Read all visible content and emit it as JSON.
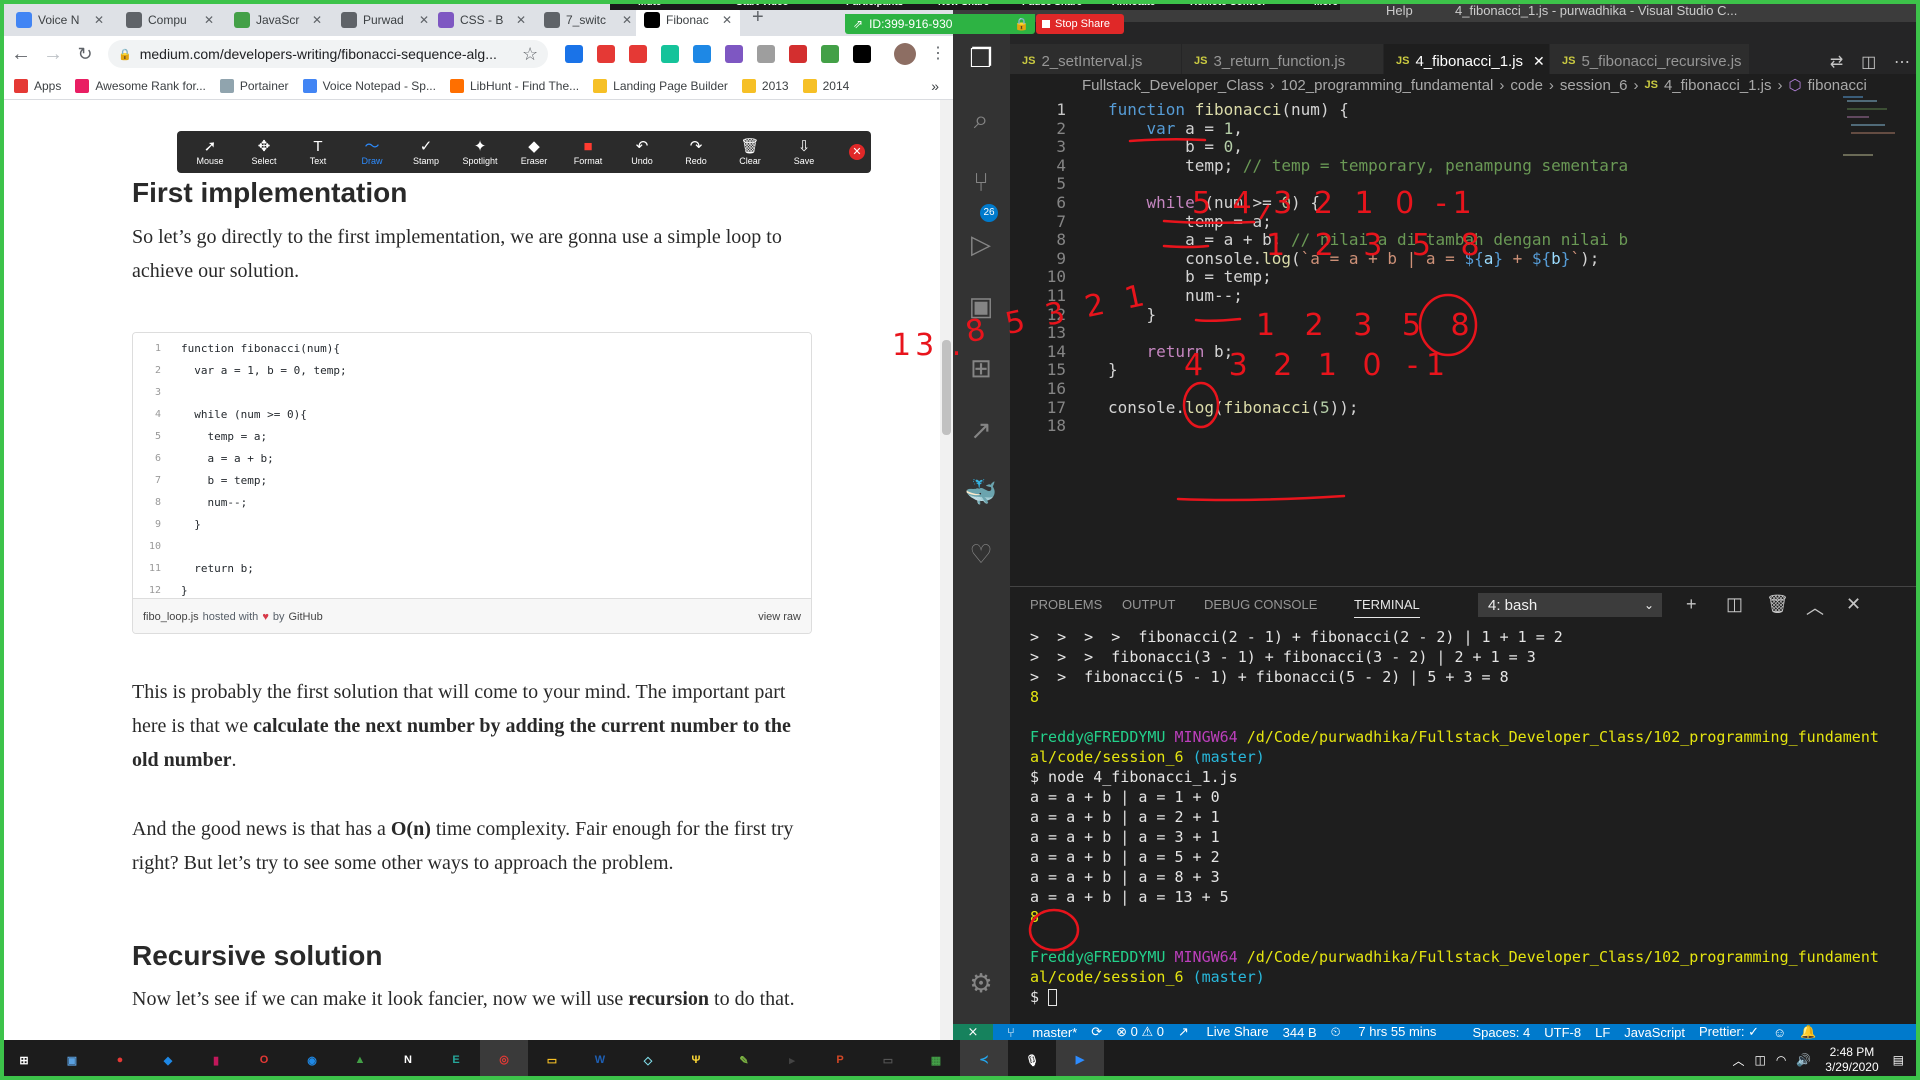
{
  "browser": {
    "tabs": [
      {
        "label": "Voice N",
        "fav": "#4285f4"
      },
      {
        "label": "Compu",
        "fav": "#5f6368"
      },
      {
        "label": "JavaScr",
        "fav": "#43a047"
      },
      {
        "label": "Purwad",
        "fav": "#5f6368"
      },
      {
        "label": "CSS - B",
        "fav": "#7e57c2"
      },
      {
        "label": "7_switc",
        "fav": "#5f6368"
      },
      {
        "label": "Fibonac",
        "fav": "#000000"
      }
    ],
    "new_tab": "+",
    "url": "medium.com/developers-writing/fibonacci-sequence-alg...",
    "bookmarks": [
      {
        "label": "Apps",
        "color": "#e53935"
      },
      {
        "label": "Awesome Rank for...",
        "color": "#e91e63"
      },
      {
        "label": "Portainer",
        "color": "#90a4ae"
      },
      {
        "label": "Voice Notepad - Sp...",
        "color": "#4285f4"
      },
      {
        "label": "LibHunt - Find The...",
        "color": "#ff6f00"
      },
      {
        "label": "Landing Page Builder",
        "color": "#f6c026"
      },
      {
        "label": "2013",
        "color": "#f6c026"
      },
      {
        "label": "2014",
        "color": "#f6c026"
      }
    ],
    "bookmarks_more": "»"
  },
  "zoom": {
    "top_items": [
      "Mute",
      "Start Video",
      "Participants",
      "New Share",
      "Pause Share",
      "Annotate",
      "Remote Control",
      "More"
    ],
    "meeting_id": "ID:399-916-930",
    "stop_share": "Stop Share",
    "toolbar": [
      {
        "label": "Mouse",
        "icon": "➚"
      },
      {
        "label": "Select",
        "icon": "✥"
      },
      {
        "label": "Text",
        "icon": "T"
      },
      {
        "label": "Draw",
        "icon": "〜"
      },
      {
        "label": "Stamp",
        "icon": "✓"
      },
      {
        "label": "Spotlight",
        "icon": "✦"
      },
      {
        "label": "Eraser",
        "icon": "◆"
      },
      {
        "label": "Format",
        "icon": "■"
      },
      {
        "label": "Undo",
        "icon": "↶"
      },
      {
        "label": "Redo",
        "icon": "↷"
      },
      {
        "label": "Clear",
        "icon": "🗑"
      },
      {
        "label": "Save",
        "icon": "⇩"
      }
    ],
    "close": "✕"
  },
  "article": {
    "heading1": "First implementation",
    "intro": "So let’s go directly to the first implementation, we are gonna use a simple loop to achieve our solution.",
    "gist_lines": [
      {
        "n": "1",
        "code": "function fibonacci(num){"
      },
      {
        "n": "2",
        "code": "  var a = 1, b = 0, temp;"
      },
      {
        "n": "3",
        "code": ""
      },
      {
        "n": "4",
        "code": "  while (num >= 0){"
      },
      {
        "n": "5",
        "code": "    temp = a;"
      },
      {
        "n": "6",
        "code": "    a = a + b;"
      },
      {
        "n": "7",
        "code": "    b = temp;"
      },
      {
        "n": "8",
        "code": "    num--;"
      },
      {
        "n": "9",
        "code": "  }"
      },
      {
        "n": "10",
        "code": ""
      },
      {
        "n": "11",
        "code": "  return b;"
      },
      {
        "n": "12",
        "code": "}"
      }
    ],
    "gist_file": "fibo_loop.js",
    "gist_hosted": "hosted with",
    "gist_by": "by",
    "gist_github": "GitHub",
    "gist_raw": "view raw",
    "p1_a": "This is probably the first solution that will come to your mind. The important part here is that we ",
    "p1_b": "calculate the next number by adding the current number to the old number",
    "p1_c": ".",
    "p2_a": "And the good news is that has a ",
    "p2_b": "O(n)",
    "p2_c": " time complexity. Fair enough for the first try right? But let’s try to see some other ways to approach the problem.",
    "heading2": "Recursive solution",
    "p3_a": "Now let’s see if we can make it look fancier, now we will use ",
    "p3_b": "recursion",
    "p3_c": " to do that."
  },
  "vscode": {
    "title_items": [
      "Help",
      "4_fibonacci_1.js - purwadhika - Visual Studio C..."
    ],
    "tabs": [
      {
        "label": "2_setInterval.js",
        "active": false
      },
      {
        "label": "3_return_function.js",
        "active": false
      },
      {
        "label": "4_fibonacci_1.js",
        "active": true
      },
      {
        "label": "5_fibonacci_recursive.js",
        "active": false
      }
    ],
    "js_tag": "JS",
    "breadcrumb": [
      "Fullstack_Developer_Class",
      "102_programming_fundamental",
      "code",
      "session_6",
      "4_fibonacci_1.js",
      "fibonacci"
    ],
    "badge": "26",
    "code_lines": [
      "function fibonacci(num) {",
      "    var a = 1,",
      "        b = 0,",
      "        temp; // temp = temporary, penampung sementara",
      "",
      "    while (num >= 0) {",
      "        temp = a;",
      "        a = a + b; // nilai a di tambah dengan nilai b",
      "        console.log(`a = a + b | a = ${a} + ${b}`);",
      "        b = temp;",
      "        num--;",
      "    }",
      "",
      "    return b;",
      "}",
      "",
      "console.log(fibonacci(5));",
      ""
    ],
    "panel_tabs": [
      "PROBLEMS",
      "OUTPUT",
      "DEBUG CONSOLE",
      "TERMINAL"
    ],
    "terminal_select": "4: bash",
    "terminal": {
      "l1": ">  >  >  >  fibonacci(2 - 1) + fibonacci(2 - 2) | 1 + 1 = 2",
      "l2": ">  >  >  fibonacci(3 - 1) + fibonacci(3 - 2) | 2 + 1 = 3",
      "l3": ">  >  fibonacci(5 - 1) + fibonacci(5 - 2) | 5 + 3 = 8",
      "l4": "8",
      "user": "Freddy@FREDDYMU",
      "env": "MINGW64",
      "path1": "/d/Code/purwadhika/Fullstack_Developer_Class/102_programming_fundament",
      "path2": "al/code/session_6",
      "branch": "(master)",
      "cmd": "$ node 4_fibonacci_1.js",
      "out": [
        "a = a + b | a = 1 + 0",
        "a = a + b | a = 2 + 1",
        "a = a + b | a = 3 + 1",
        "a = a + b | a = 5 + 2",
        "a = a + b | a = 8 + 3",
        "a = a + b | a = 13 + 5"
      ],
      "result": "8",
      "prompt": "$ "
    },
    "status": {
      "branch": "master*",
      "problems": "⊗ 0 ⚠ 0",
      "liveshare": "Live Share",
      "size": "344 B",
      "time": "7 hrs 55 mins",
      "spaces": "Spaces: 4",
      "encoding": "UTF-8",
      "eol": "LF",
      "language": "JavaScript",
      "prettier": "Prettier: ✓"
    }
  },
  "annotations": {
    "row1": "5 4 3 2 1 0 -1",
    "row2": "1 2 3 5 8",
    "row3": "1 2 3 5 8",
    "row4": "4 3 2 1 0 -1",
    "left1": "8 5 3 2 1",
    "left2": "13 ."
  },
  "taskbar": {
    "time": "2:48 PM",
    "date": "3/29/2020"
  }
}
